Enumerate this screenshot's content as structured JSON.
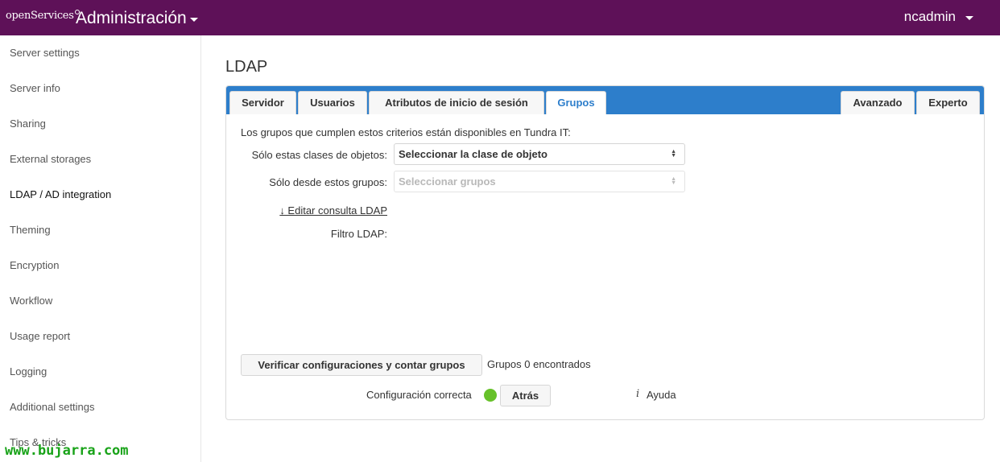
{
  "header": {
    "logo_text": "openServices",
    "app_title": "Administración",
    "user_name": "ncadmin"
  },
  "sidebar": {
    "items": [
      {
        "label": "Server settings"
      },
      {
        "label": "Server info"
      },
      {
        "label": "Sharing"
      },
      {
        "label": "External storages"
      },
      {
        "label": "LDAP / AD integration"
      },
      {
        "label": "Theming"
      },
      {
        "label": "Encryption"
      },
      {
        "label": "Workflow"
      },
      {
        "label": "Usage report"
      },
      {
        "label": "Logging"
      },
      {
        "label": "Additional settings"
      },
      {
        "label": "Tips & tricks"
      }
    ],
    "active_index": 4
  },
  "watermark": "www.bujarra.com",
  "main": {
    "title": "LDAP",
    "tabs": {
      "servidor": "Servidor",
      "usuarios": "Usuarios",
      "atributos": "Atributos de inicio de sesión",
      "grupos": "Grupos",
      "avanzado": "Avanzado",
      "experto": "Experto"
    },
    "active_tab": "Grupos",
    "intro": "Los grupos que cumplen estos criterios están disponibles en Tundra IT:",
    "object_classes_label": "Sólo estas clases de objetos:",
    "object_classes_value": "Seleccionar la clase de objeto",
    "groups_label": "Sólo desde estos grupos:",
    "groups_value": "Seleccionar grupos",
    "edit_query_link": "↓ Editar consulta LDAP",
    "filter_label": "Filtro LDAP:",
    "verify_button": "Verificar configuraciones y contar grupos",
    "count_text": "Grupos 0 encontrados",
    "status_text": "Configuración correcta",
    "back_button": "Atrás",
    "help_icon": "i",
    "help_text": "Ayuda"
  },
  "colors": {
    "header_bg": "#5e1158",
    "tab_bar": "#2d7ecb",
    "status_ok": "#67c12a"
  }
}
